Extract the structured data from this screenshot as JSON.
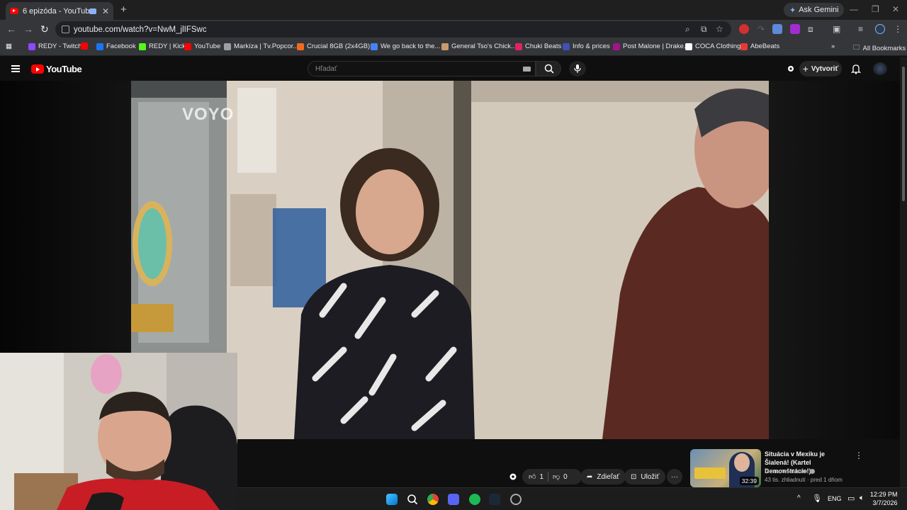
{
  "browser": {
    "tab_title": "6 epizóda - YouTube",
    "new_tab": "+",
    "ask_gemini": "Ask Gemini",
    "url": "youtube.com/watch?v=NwM_jlIFSwc",
    "bookmarks": [
      {
        "label": "REDY - Twitch",
        "color": "#9146ff"
      },
      {
        "label": "",
        "color": "#ff0000"
      },
      {
        "label": "Facebook",
        "color": "#1877f2"
      },
      {
        "label": "REDY | Kick",
        "color": "#53fc18"
      },
      {
        "label": "YouTube",
        "color": "#ff0000"
      },
      {
        "label": "Markíza | Tv.Popcor...",
        "color": "#9aa0a6"
      },
      {
        "label": "Crucial 8GB (2x4GB)...",
        "color": "#f26b1d"
      },
      {
        "label": "We go back to the...",
        "color": "#4285f4"
      },
      {
        "label": "General Tso's Chick...",
        "color": "#c89b6d"
      },
      {
        "label": "Chuki Beats",
        "color": "#e0245e"
      },
      {
        "label": "Info & prices",
        "color": "#3f51b5"
      },
      {
        "label": "Post Malone | Drake...",
        "color": "#a0148c"
      },
      {
        "label": "COCA Clothing",
        "color": "#ffffff"
      },
      {
        "label": "AbeBeats",
        "color": "#e53935"
      }
    ],
    "all_bookmarks": "All Bookmarks",
    "more_bookmarks": "»"
  },
  "youtube": {
    "logo_text": "YouTube",
    "search_placeholder": "Hľadať",
    "create_label": "Vytvoriť"
  },
  "video": {
    "watermark": "VOYO"
  },
  "actions": {
    "like_count": "1",
    "dislike_count": "0",
    "share_label": "Zdieľať",
    "save_label": "Uložiť",
    "more": "···"
  },
  "recommended": {
    "title": "Situácia v Mexiku je Šialená! (Kartel Demonštrácie!)",
    "channel": "menameselassie",
    "meta": "43 tis. zhliadnutí · pred 1 dňom",
    "duration": "32:39",
    "more": "⋮"
  },
  "taskbar": {
    "lang": "ENG",
    "time": "12:29 PM",
    "date": "3/7/2026"
  }
}
